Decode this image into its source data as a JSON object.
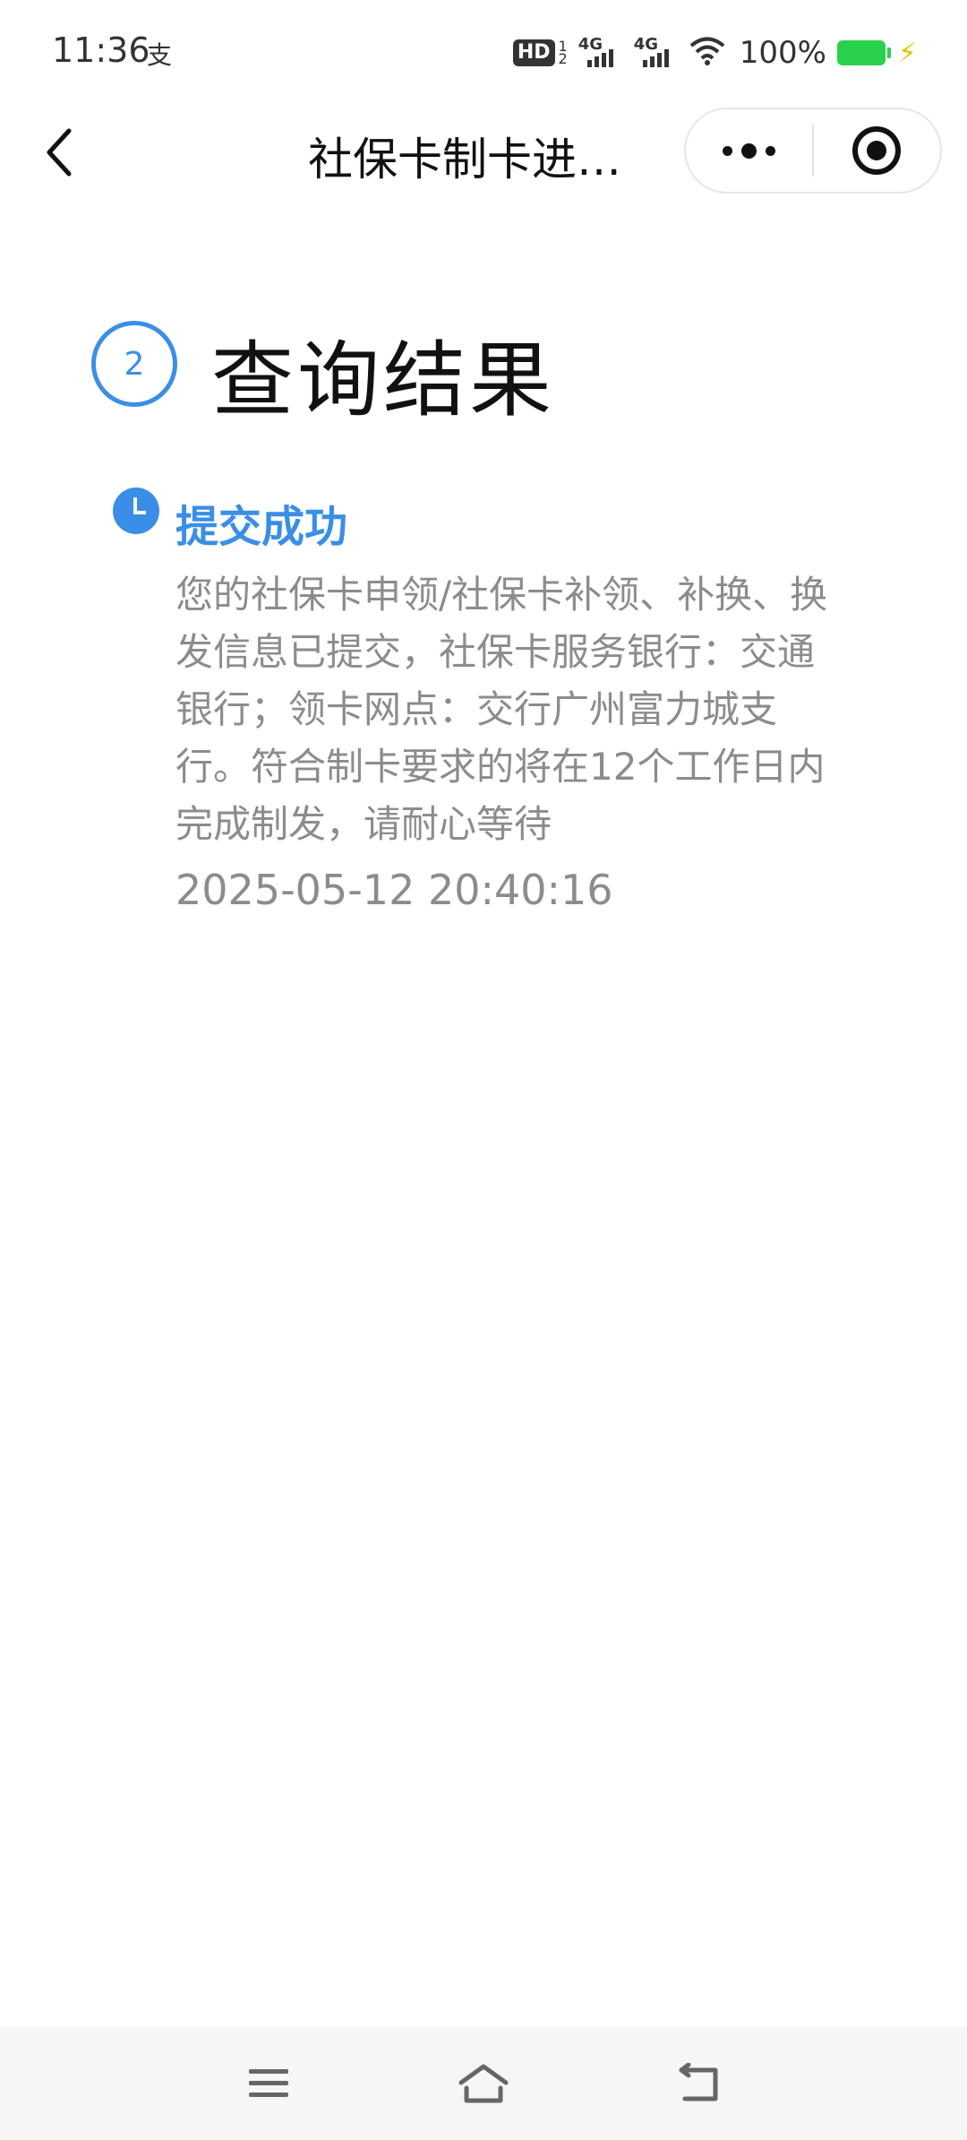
{
  "status_bar": {
    "time": "11:36",
    "alipay_glyph": "支",
    "hd_label": "HD",
    "hd_sup": "1",
    "hd_sub": "2",
    "network_1": "4G",
    "network_2": "4G",
    "battery": "100%",
    "icons": [
      "wifi-icon",
      "battery-icon",
      "charging-bolt-icon"
    ],
    "battery_color": "#2ad14b"
  },
  "nav_bar": {
    "title": "社保卡制卡进…",
    "back_icon": "chevron-left-icon",
    "more_icon": "more-dots-icon",
    "close_icon": "target-close-icon"
  },
  "main": {
    "step_number": "2",
    "heading": "查询结果",
    "accent_color": "#3a8ee6",
    "timeline": [
      {
        "status": "提交成功",
        "description": "您的社保卡申领/社保卡补领、补换、换发信息已提交，社保卡服务银行：交通银行；领卡网点：交行广州富力城支行。符合制卡要求的将在12个工作日内完成制发，请耐心等待",
        "timestamp": "2025-05-12 20:40:16"
      }
    ]
  },
  "bottom_nav": {
    "icons": [
      "menu-icon",
      "home-icon",
      "back-icon"
    ]
  }
}
